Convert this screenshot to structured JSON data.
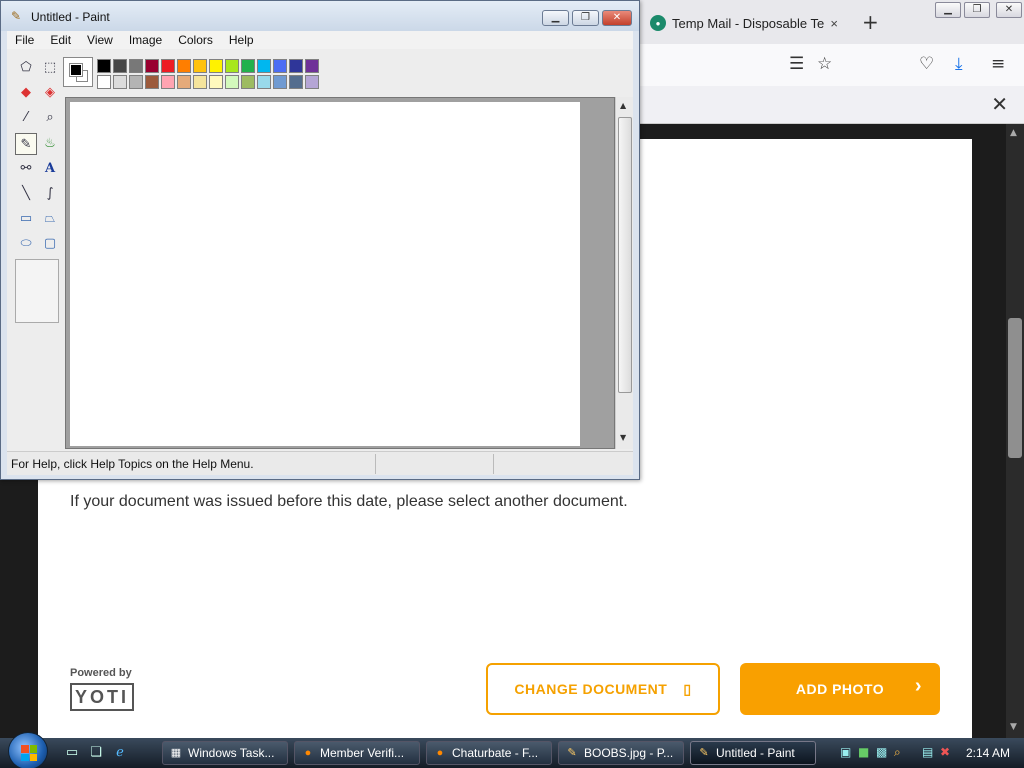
{
  "browser": {
    "tab_title": "Temp Mail - Disposable Temp",
    "tab_favicon": "tm-favicon",
    "tab_close": "×",
    "new_tab": "+",
    "content_text": "If your document was issued before this date, please select another document.",
    "powered_by": "Powered by",
    "yoti_logo": "YOTI",
    "change_document_label": "CHANGE DOCUMENT",
    "add_photo_label": "ADD PHOTO",
    "accent_color": "#f9a000"
  },
  "paint": {
    "title": "Untitled - Paint",
    "menu": [
      "File",
      "Edit",
      "View",
      "Image",
      "Colors",
      "Help"
    ],
    "status_text": "For Help, click Help Topics on the Help Menu.",
    "palette_top": [
      "#000000",
      "#464646",
      "#787878",
      "#990030",
      "#ed1c24",
      "#ff7e00",
      "#ffc20e",
      "#fff200",
      "#a8e61d",
      "#22b14c",
      "#00b7ef",
      "#4d6df3",
      "#2f3699",
      "#6f3198"
    ],
    "palette_bottom": [
      "#ffffff",
      "#dcdcdc",
      "#b4b4b4",
      "#9c5a3c",
      "#ffa3b1",
      "#e5aa7a",
      "#f5e49c",
      "#fff9bd",
      "#d3f9bc",
      "#9dbb61",
      "#99d9ea",
      "#709ad1",
      "#546d8e",
      "#b5a5d5"
    ]
  },
  "taskbar": {
    "items": [
      {
        "label": "Windows Task...",
        "icon": "task-manager-icon"
      },
      {
        "label": "Member Verifi...",
        "icon": "firefox-icon"
      },
      {
        "label": "Chaturbate - F...",
        "icon": "firefox-icon"
      },
      {
        "label": "BOOBS.jpg - P...",
        "icon": "paint-icon"
      },
      {
        "label": "Untitled - Paint",
        "icon": "paint-icon"
      }
    ],
    "clock": "2:14 AM"
  }
}
